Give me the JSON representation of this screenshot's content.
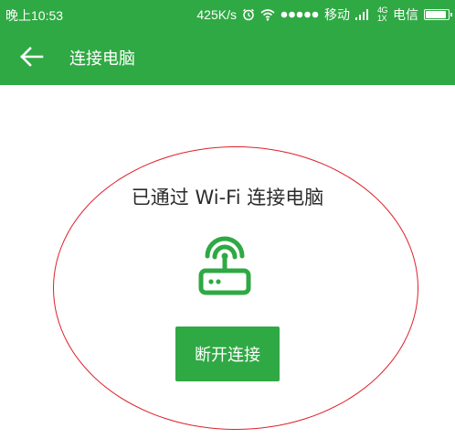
{
  "status_bar": {
    "time": "晚上10:53",
    "network_speed": "425K/s",
    "carrier_1": "移动",
    "signal_mini": "4G\n1X",
    "carrier_2": "电信"
  },
  "app_bar": {
    "title": "连接电脑"
  },
  "main": {
    "connected_text": "已通过 Wi-Fi 连接电脑",
    "disconnect_button": "断开连接"
  },
  "colors": {
    "primary": "#2fa943",
    "annotation_ellipse": "#e0202a"
  },
  "icons": {
    "back": "arrow-left-icon",
    "router": "wifi-router-icon",
    "alarm": "alarm-clock-icon",
    "wifi": "wifi-icon",
    "signal": "signal-dots-icon",
    "battery": "battery-icon"
  }
}
